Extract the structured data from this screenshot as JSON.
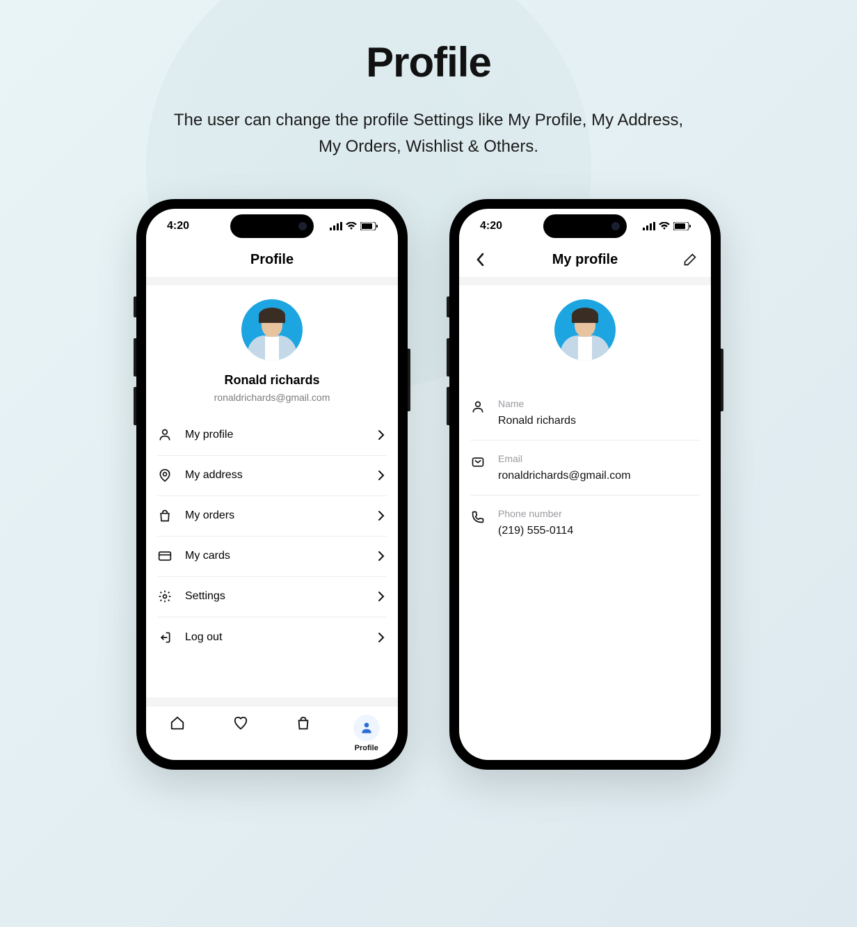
{
  "header": {
    "title": "Profile",
    "subtitle_line1": "The user can change the profile Settings like My Profile, My Address,",
    "subtitle_line2": "My Orders, Wishlist & Others."
  },
  "status": {
    "time": "4:20"
  },
  "screen1": {
    "nav_title": "Profile",
    "user_name": "Ronald richards",
    "user_email": "ronaldrichards@gmail.com",
    "menu": [
      {
        "label": "My profile"
      },
      {
        "label": "My address"
      },
      {
        "label": "My orders"
      },
      {
        "label": "My cards"
      },
      {
        "label": "Settings"
      },
      {
        "label": "Log out"
      }
    ],
    "tabs": {
      "profile_label": "Profile"
    }
  },
  "screen2": {
    "nav_title": "My profile",
    "fields": {
      "name_label": "Name",
      "name_value": "Ronald richards",
      "email_label": "Email",
      "email_value": "ronaldrichards@gmail.com",
      "phone_label": "Phone number",
      "phone_value": "(219) 555-0114"
    }
  }
}
